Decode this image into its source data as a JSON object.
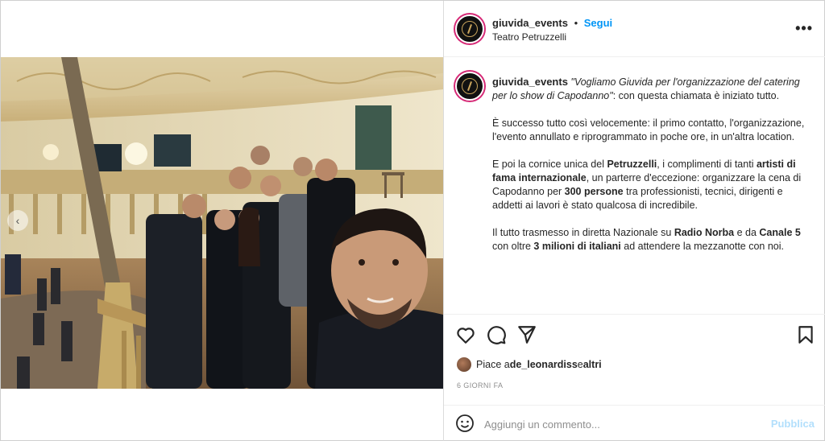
{
  "header": {
    "username": "giuvida_events",
    "separator": "•",
    "follow_label": "Segui",
    "location": "Teatro Petruzzelli",
    "more_label": "•••"
  },
  "caption": {
    "username": "giuvida_events",
    "quote": "\"Vogliamo Giuvida per l'organizzazione del catering per lo show di Capodanno\"",
    "quote_tail": ": con questa chiamata è iniziato tutto.",
    "p2": "È successo tutto così velocemente: il primo contatto, l'organizzazione, l'evento annullato e riprogrammato in poche ore, in un'altra location.",
    "p3_a": "E poi la cornice unica del ",
    "p3_b": "Petruzzelli",
    "p3_c": ", i complimenti di tanti ",
    "p3_d": "artisti di fama internazionale",
    "p3_e": ", un parterre d'eccezione: organizzare la cena di Capodanno per ",
    "p3_f": "300 persone",
    "p3_g": " tra professionisti, tecnici, dirigenti e addetti ai lavori è stato qualcosa di incredibile.",
    "p4_a": "Il tutto trasmesso in diretta Nazionale su ",
    "p4_b": "Radio Norba",
    "p4_c": " e da ",
    "p4_d": "Canale 5",
    "p4_e": " con oltre ",
    "p4_f": "3 milioni di italiani",
    "p4_g": " ad attendere la mezzanotte con noi."
  },
  "actions": {
    "icons": [
      "heart-icon",
      "comment-icon",
      "share-icon",
      "bookmark-icon"
    ]
  },
  "likes": {
    "prefix": "Piace a ",
    "user": "de_leonardiss",
    "middle": " e ",
    "others": "altri"
  },
  "time_ago": "6 GIORNI FA",
  "comment": {
    "placeholder": "Aggiungi un commento...",
    "publish_label": "Pubblica"
  },
  "colors": {
    "link_blue": "#0095f6",
    "publish_disabled": "#b2dffc",
    "muted_text": "#8e8e8e",
    "story_ring": "#d62976"
  }
}
